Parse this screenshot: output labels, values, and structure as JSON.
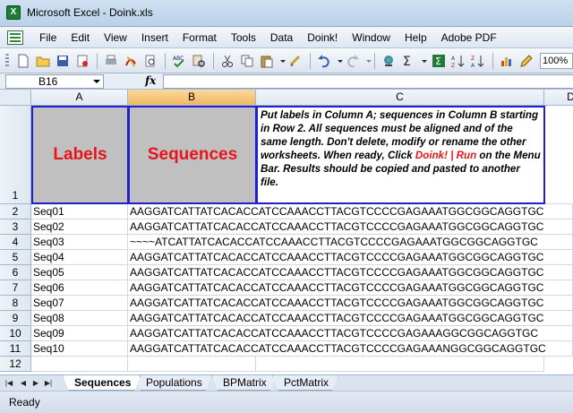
{
  "window": {
    "title": "Microsoft Excel - Doink.xls"
  },
  "menu": [
    "File",
    "Edit",
    "View",
    "Insert",
    "Format",
    "Tools",
    "Data",
    "Doink!",
    "Window",
    "Help",
    "Adobe PDF"
  ],
  "toolbar": {
    "zoom": "100%"
  },
  "formula_bar": {
    "name_box": "B16",
    "fx_label": "fx",
    "formula": ""
  },
  "columns": [
    "A",
    "B",
    "C",
    "D"
  ],
  "rows": [
    "1",
    "2",
    "3",
    "4",
    "5",
    "6",
    "7",
    "8",
    "9",
    "10",
    "11",
    "12"
  ],
  "header_row": {
    "labels": "Labels",
    "sequences": "Sequences",
    "note_part1": "Put labels in Column A; sequences in Column B starting in Row 2. All sequences must be aligned and of the same length. Don't delete, modify or rename the other worksheets. When ready,  Click ",
    "note_link": "Doink! | Run",
    "note_part2": " on the Menu Bar. Results should be copied and pasted to another file."
  },
  "data_rows": [
    {
      "label": "Seq01",
      "seq": "AAGGATCATTATCACACCATCCAAACCTTACGTCCCCGAGAAATGGCGGCAGGTGC"
    },
    {
      "label": "Seq02",
      "seq": "AAGGATCATTATCACACCATCCAAACCTTACGTCCCCGAGAAATGGCGGCAGGTGC"
    },
    {
      "label": "Seq03",
      "seq": "~~~~ATCATTATCACACCATCCAAACCTTACGTCCCCGAGAAATGGCGGCAGGTGC"
    },
    {
      "label": "Seq04",
      "seq": "AAGGATCATTATCACACCATCCAAACCTTACGTCCCCGAGAAATGGCGGCAGGTGC"
    },
    {
      "label": "Seq05",
      "seq": "AAGGATCATTATCACACCATCCAAACCTTACGTCCCCGAGAAATGGCGGCAGGTGC"
    },
    {
      "label": "Seq06",
      "seq": "AAGGATCATTATCACACCATCCAAACCTTACGTCCCCGAGAAATGGCGGCAGGTGC"
    },
    {
      "label": "Seq07",
      "seq": "AAGGATCATTATCACACCATCCAAACCTTACGTCCCCGAGAAATGGCGGCAGGTGC"
    },
    {
      "label": "Seq08",
      "seq": "AAGGATCATTATCACACCATCCAAACCTTACGTCCCCGAGAAATGGCGGCAGGTGC"
    },
    {
      "label": "Seq09",
      "seq": "AAGGATCATTATCACACCATCCAAACCTTACGTCCCCGAGAAAGGCGGCAGGTGC"
    },
    {
      "label": "Seq10",
      "seq": "AAGGATCATTATCACACCATCCAAACCTTACGTCCCCGAGAAANGGCGGCAGGTGC"
    }
  ],
  "sheet_tabs": [
    "Sequences",
    "Populations",
    "BPMatrix",
    "PctMatrix"
  ],
  "status": {
    "text": "Ready"
  },
  "colors": {
    "header_red": "#e8141a",
    "header_border": "#1f1fd0",
    "active_col": "#f1b760"
  }
}
